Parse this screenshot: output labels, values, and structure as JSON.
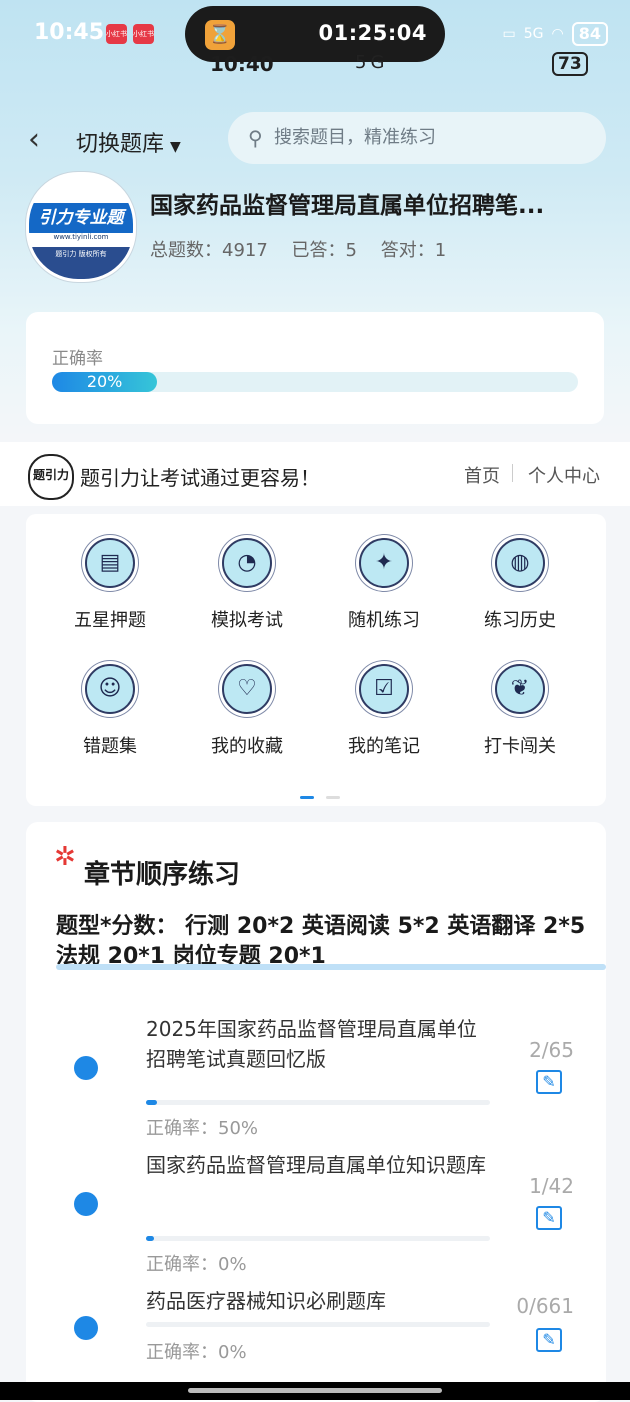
{
  "status_bar": {
    "time": "10:45",
    "app_badge_1": "小红书",
    "app_badge_2": "小红书",
    "timer": "01:25:04",
    "network": "5G",
    "battery": "84",
    "ghost_time": "10:40",
    "ghost_network": "5G",
    "ghost_battery": "73"
  },
  "header": {
    "switch_label": "切换题库",
    "search_placeholder": "搜索题目，精准练习"
  },
  "bank": {
    "logo_text": "引力专业题",
    "logo_url": "www.tiyinli.com",
    "logo_footer": "题引力 版权所有",
    "title": "国家药品监督管理局直属单位招聘笔...",
    "total_label": "总题数：4917",
    "answered_label": "已答：5",
    "correct_label": "答对：1"
  },
  "accuracy": {
    "label": "正确率",
    "value_text": "20%",
    "value": 0.2
  },
  "banner": {
    "logo_text": "题引力",
    "slogan": "题引力让考试通过更容易！",
    "home": "首页",
    "personal_center": "个人中心"
  },
  "features": [
    {
      "label": "五星押题",
      "icon": "id-card-icon"
    },
    {
      "label": "模拟考试",
      "icon": "gauge-icon"
    },
    {
      "label": "随机练习",
      "icon": "star-icon"
    },
    {
      "label": "练习历史",
      "icon": "globe-icon"
    },
    {
      "label": "错题集",
      "icon": "head-icon"
    },
    {
      "label": "我的收藏",
      "icon": "heart-icon"
    },
    {
      "label": "我的笔记",
      "icon": "note-icon"
    },
    {
      "label": "打卡闯关",
      "icon": "leaf-icon"
    }
  ],
  "chapter": {
    "title": "章节顺序练习",
    "description": "题型*分数： 行测 20*2 英语阅读 5*2 英语翻译 2*5 法规 20*1 岗位专题 20*1",
    "items": [
      {
        "name": "2025年国家药品监督管理局直属单位招聘笔试真题回忆版",
        "rate": "正确率：50%",
        "count": "2/65",
        "progress": 0.031
      },
      {
        "name": "国家药品监督管理局直属单位知识题库",
        "rate": "正确率：0%",
        "count": "1/42",
        "progress": 0.024
      },
      {
        "name": "药品医疗器械知识必刷题库",
        "rate": "正确率：0%",
        "count": "0/661",
        "progress": 0
      }
    ]
  }
}
